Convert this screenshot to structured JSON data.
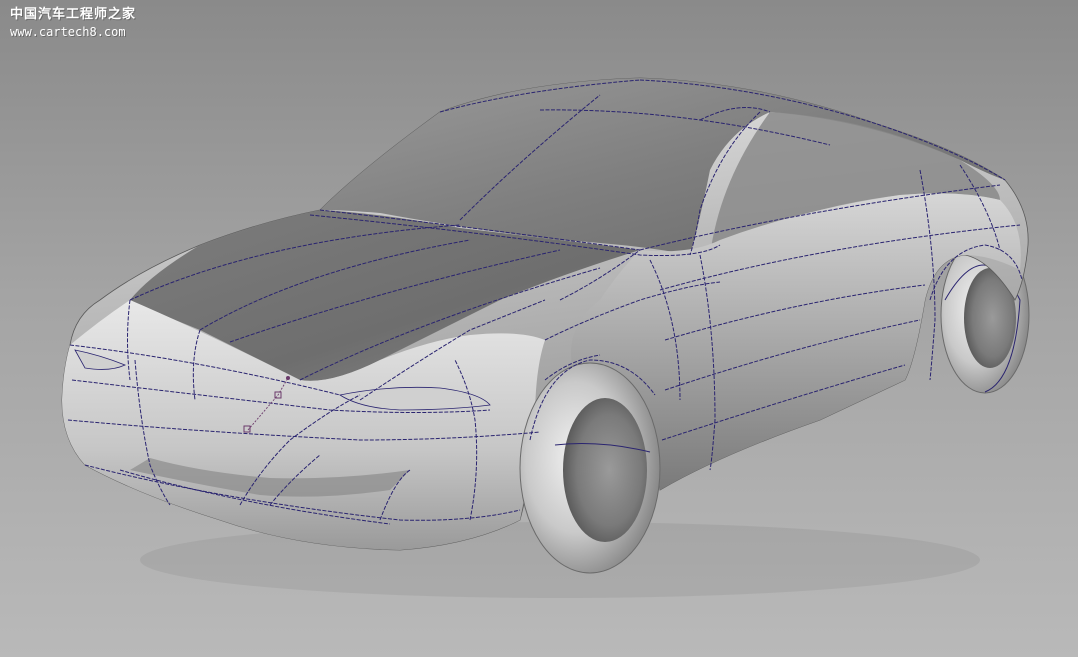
{
  "watermark": {
    "site_name": "中国汽车工程师之家",
    "url": "www.cartech8.com"
  },
  "scene": {
    "subject": "car-surface-model",
    "background_color": "#a0a0a0",
    "isoparm_color": "#2a2470"
  }
}
